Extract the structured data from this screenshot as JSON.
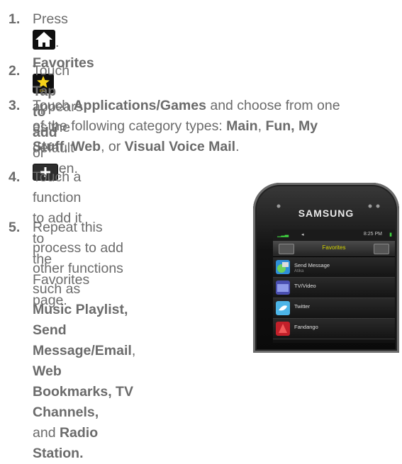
{
  "steps": [
    {
      "num": "1.",
      "t1": "Press",
      "t2": ".",
      "t3": "Favorites",
      "t4": "appears as the default",
      "t5": "screen."
    },
    {
      "num": "2.",
      "t1": "Touch",
      "t2": "Tap to add",
      "t3": "or",
      "t4": "."
    },
    {
      "num": "3.",
      "t1": "Touch",
      "t2": "Applications/Games",
      "t3": "and choose from one",
      "t4": "of the following category types:",
      "t5": "Main",
      "t6": ",",
      "t7": "Fun, My",
      "t8": "Stuff",
      "t9": ",",
      "t10": "Web",
      "t11": ", or",
      "t12": "Visual Voice Mail",
      "t13": "."
    },
    {
      "num": "4.",
      "l1": "Touch a function to add it to",
      "l2": "the Favorites page."
    },
    {
      "num": "5.",
      "l1": "Repeat this process to add",
      "l2": "other functions such as",
      "b1": "Music Playlist, Send",
      "b2a": "Message/Email",
      "b2b": ",",
      "b2c": "Web",
      "b3": "Bookmarks, TV Channels,",
      "l4a": "and",
      "l4b": "Radio Station."
    }
  ],
  "icons": {
    "home": "home-icon",
    "favs": "favs-star-icon",
    "favs_label": "Favs",
    "plus": "plus-icon"
  },
  "phone": {
    "brand": "SAMSUNG",
    "time": "8:25 PM",
    "title": "Favorites",
    "rows": [
      {
        "label": "Send Message",
        "sub": "Atika"
      },
      {
        "label": "TV/Video",
        "sub": ""
      },
      {
        "label": "Twitter",
        "sub": ""
      },
      {
        "label": "Fandango",
        "sub": ""
      }
    ]
  }
}
